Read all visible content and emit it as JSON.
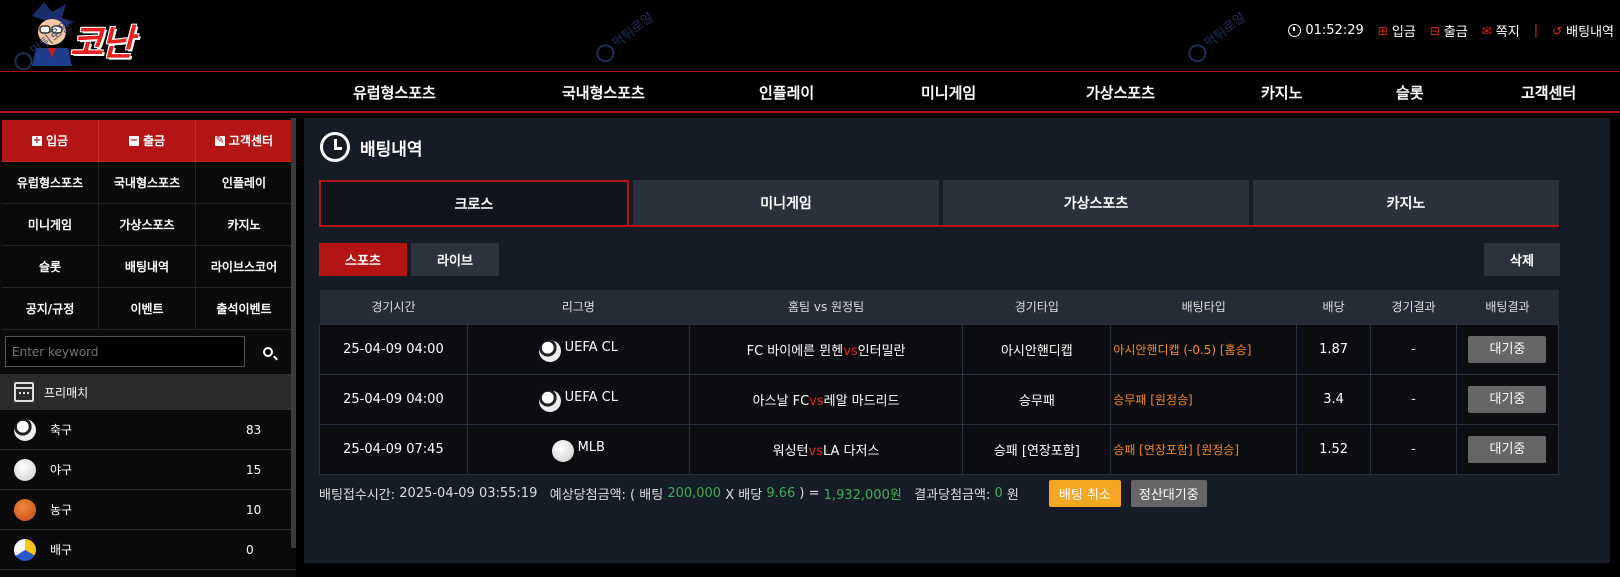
{
  "header": {
    "logo_text": "코난",
    "watermark_text": "먹튀로얄",
    "time": "01:52:29",
    "deposit": "입금",
    "withdraw": "출금",
    "message": "쪽지",
    "bet_history": "배팅내역"
  },
  "mainnav": [
    "유럽형스포츠",
    "국내형스포츠",
    "인플레이",
    "미니게임",
    "가상스포츠",
    "카지노",
    "슬롯",
    "고객센터"
  ],
  "sidebar": {
    "top_buttons": [
      "입금",
      "출금",
      "고객센터"
    ],
    "grid": [
      "유럽형스포츠",
      "국내형스포츠",
      "인플레이",
      "미니게임",
      "가상스포츠",
      "카지노",
      "슬롯",
      "배팅내역",
      "라이브스코어",
      "공지/규정",
      "이벤트",
      "출석이벤트"
    ],
    "search_placeholder": "Enter keyword",
    "prematch": "프리매치",
    "sports": [
      {
        "name": "축구",
        "count": "83"
      },
      {
        "name": "야구",
        "count": "15"
      },
      {
        "name": "농구",
        "count": "10"
      },
      {
        "name": "배구",
        "count": "0"
      }
    ]
  },
  "content": {
    "title": "배팅내역",
    "tabs": [
      "크로스",
      "미니게임",
      "가상스포츠",
      "카지노"
    ],
    "subtabs": [
      "스포츠",
      "라이브"
    ],
    "delete_label": "삭제",
    "columns": [
      "경기시간",
      "리그명",
      "홈팀 vs 원정팀",
      "경기타입",
      "배팅타입",
      "배당",
      "경기결과",
      "배팅결과"
    ],
    "rows": [
      {
        "time": "25-04-09 04:00",
        "league": "UEFA CL",
        "home": "FC 바이에른 뮌헨",
        "vs": "vs",
        "away": "인터밀란",
        "type": "아시안핸디캡",
        "bet": "아시안핸디캡 (-0.5) [홈승]",
        "odds": "1.87",
        "result": "-",
        "status": "대기중"
      },
      {
        "time": "25-04-09 04:00",
        "league": "UEFA CL",
        "home": "아스날 FC",
        "vs": "vs",
        "away": "레알 마드리드",
        "type": "승무패",
        "bet": "승무패 [원정승]",
        "odds": "3.4",
        "result": "-",
        "status": "대기중"
      },
      {
        "time": "25-04-09 07:45",
        "league": "MLB",
        "home": "워싱턴",
        "vs": "vs",
        "away": "LA 다저스",
        "type": "승패 [연장포함]",
        "bet": "승패 [연장포함] [원정승]",
        "odds": "1.52",
        "result": "-",
        "status": "대기중"
      }
    ],
    "summary": {
      "accept_label": "배팅접수시간:",
      "accept_time": "2025-04-09 03:55:19",
      "expected_label": "예상당첨금액: ( 배팅",
      "bet_amount": "200,000",
      "x_odds_label": "X 배당",
      "total_odds": "9.66",
      "equals": ") =",
      "expected_win": "1,932,000원",
      "result_label": "결과당첨금액:",
      "result_amount": "0",
      "won": "원",
      "cancel_label": "배팅 취소",
      "settle_label": "정산대기중"
    }
  },
  "colors": {
    "accent": "#b31414",
    "orange": "#f5891e",
    "green": "#3fae5a",
    "panel": "#161c26"
  }
}
